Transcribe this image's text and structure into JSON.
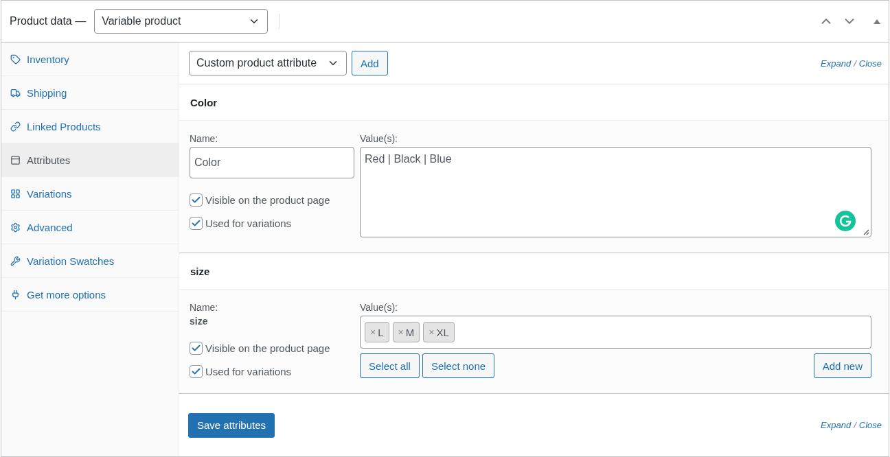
{
  "header": {
    "title": "Product data —",
    "product_type": "Variable product"
  },
  "sidebar": {
    "items": [
      {
        "label": "Inventory",
        "selected": false
      },
      {
        "label": "Shipping",
        "selected": false
      },
      {
        "label": "Linked Products",
        "selected": false
      },
      {
        "label": "Attributes",
        "selected": true
      },
      {
        "label": "Variations",
        "selected": false
      },
      {
        "label": "Advanced",
        "selected": false
      },
      {
        "label": "Variation Swatches",
        "selected": false
      },
      {
        "label": "Get more options",
        "selected": false
      }
    ]
  },
  "toolbar": {
    "attribute_select": "Custom product attribute",
    "add_button": "Add",
    "expand": "Expand",
    "separator": "/",
    "close": "Close"
  },
  "attributes": [
    {
      "kind": "custom",
      "title": "Color",
      "name_label": "Name:",
      "name": "Color",
      "values_label": "Value(s):",
      "values_text": "Red | Black | Blue",
      "checks": [
        {
          "label": "Visible on the product page",
          "checked": true
        },
        {
          "label": "Used for variations",
          "checked": true
        }
      ]
    },
    {
      "kind": "taxonomy",
      "title": "size",
      "name_label": "Name:",
      "name": "size",
      "values_label": "Value(s):",
      "tags": [
        {
          "remove": "×",
          "label": "L"
        },
        {
          "remove": "×",
          "label": "M"
        },
        {
          "remove": "×",
          "label": "XL"
        }
      ],
      "buttons": [
        "Select all",
        "Select none"
      ],
      "add_new": "Add new",
      "checks": [
        {
          "label": "Visible on the product page",
          "checked": true
        },
        {
          "label": "Used for variations",
          "checked": true
        }
      ]
    }
  ],
  "footer": {
    "save_button": "Save attributes",
    "expand": "Expand",
    "separator": "/",
    "close": "Close"
  }
}
